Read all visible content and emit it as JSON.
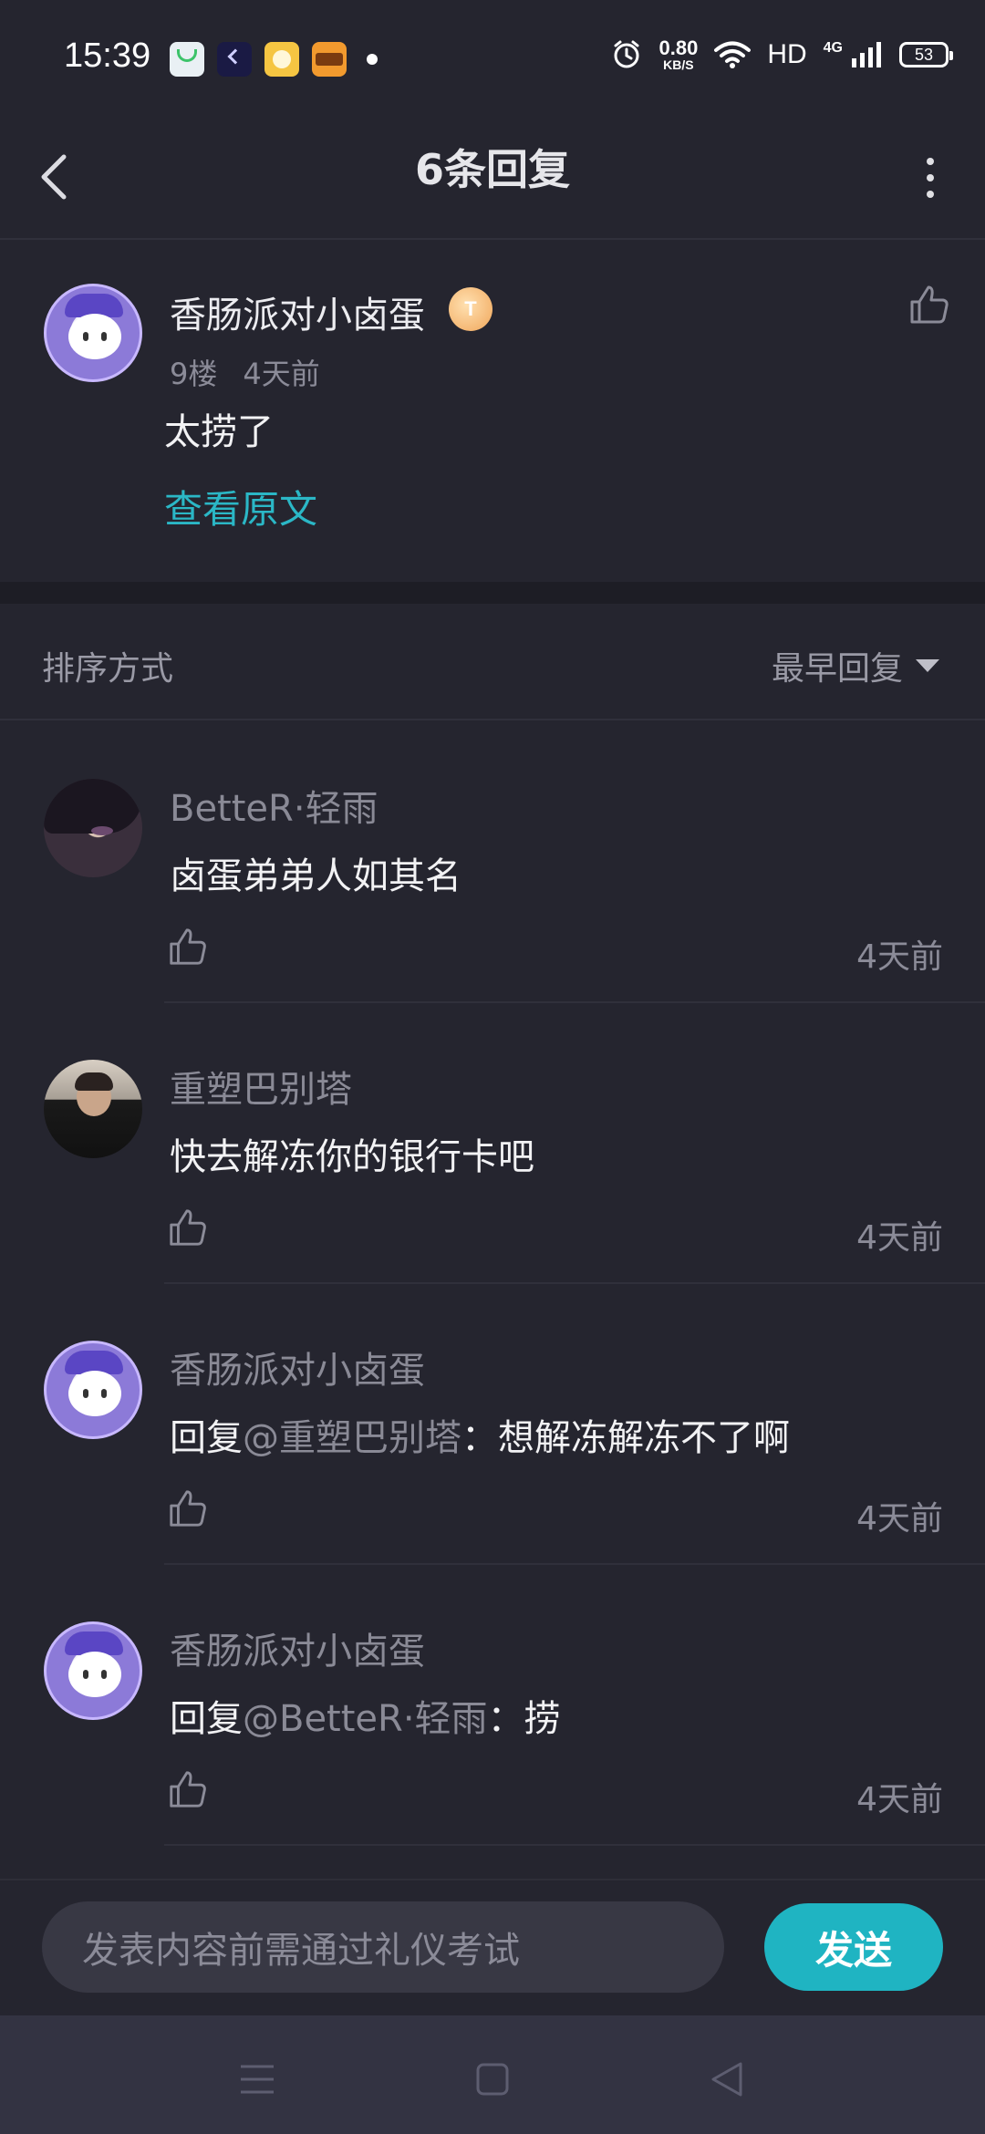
{
  "status_bar": {
    "time": "15:39",
    "net_speed_value": "0.80",
    "net_speed_unit": "KB/S",
    "hd": "HD",
    "network": "4G",
    "battery": "53",
    "notif_icons": [
      {
        "name": "app-notification-icon-1",
        "color": "#e9f0f4"
      },
      {
        "name": "app-notification-icon-2",
        "color": "#1a1a44"
      },
      {
        "name": "app-notification-icon-3",
        "color": "#f5c542"
      },
      {
        "name": "app-notification-icon-4",
        "color": "#f29a2e"
      }
    ]
  },
  "header": {
    "title": "6条回复"
  },
  "origin_post": {
    "author": "香肠派对小卤蛋",
    "badge": "T",
    "floor": "9楼",
    "time": "4天前",
    "content": "太捞了",
    "view_original": "查看原文"
  },
  "sort": {
    "label": "排序方式",
    "selected": "最早回复"
  },
  "replies": [
    {
      "author": "BetteR·轻雨",
      "prefix": "",
      "mention": "",
      "text": "卤蛋弟弟人如其名",
      "time": "4天前"
    },
    {
      "author": "重塑巴别塔",
      "prefix": "",
      "mention": "",
      "text": "快去解冻你的银行卡吧",
      "time": "4天前"
    },
    {
      "author": "香肠派对小卤蛋",
      "prefix": "回复",
      "mention": "@重塑巴别塔",
      "text": "：想解冻解冻不了啊",
      "time": "4天前"
    },
    {
      "author": "香肠派对小卤蛋",
      "prefix": "回复",
      "mention": "@BetteR·轻雨",
      "text": "：捞",
      "time": "4天前"
    }
  ],
  "composer": {
    "placeholder": "发表内容前需通过礼仪考试",
    "send_label": "发送"
  },
  "colors": {
    "background": "#25252f",
    "accent": "#1fb4c2",
    "link": "#2bb7c6",
    "muted_text": "#8b8b98"
  }
}
